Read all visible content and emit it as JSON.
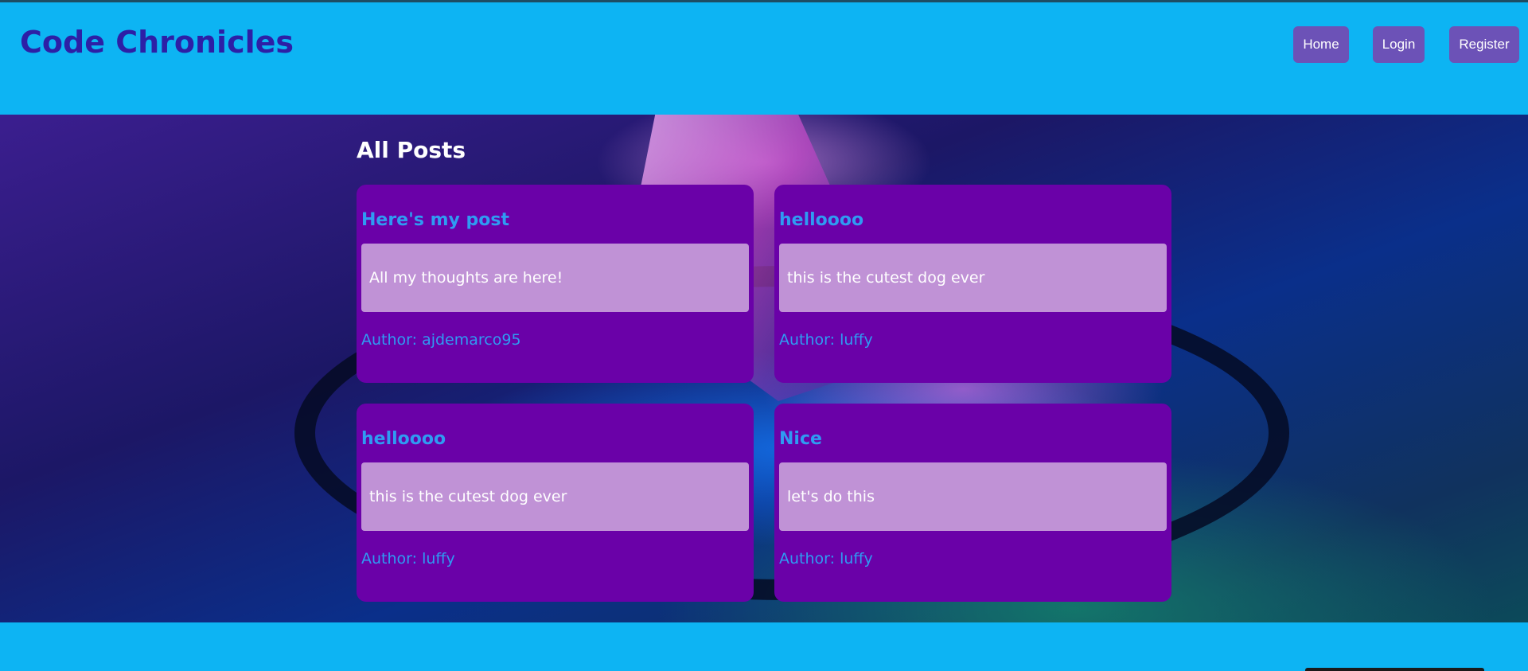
{
  "header": {
    "site_title": "Code Chronicles",
    "nav": {
      "home": "Home",
      "login": "Login",
      "register": "Register"
    }
  },
  "main": {
    "heading": "All Posts",
    "posts": [
      {
        "title": "Here's my post",
        "body": "All my thoughts are here!",
        "author": "Author: ajdemarco95"
      },
      {
        "title": "helloooo",
        "body": "this is the cutest dog ever",
        "author": "Author: luffy"
      },
      {
        "title": "helloooo",
        "body": "this is the cutest dog ever",
        "author": "Author: luffy"
      },
      {
        "title": "Nice",
        "body": "let's do this",
        "author": "Author: luffy"
      }
    ]
  },
  "colors": {
    "header_bg": "#0db4f3",
    "title_color": "#2d1fa6",
    "nav_button_bg": "#6c52b7",
    "card_bg": "#6a01a8",
    "card_title": "#2f9bf2",
    "card_body_bg": "#c092d6"
  }
}
